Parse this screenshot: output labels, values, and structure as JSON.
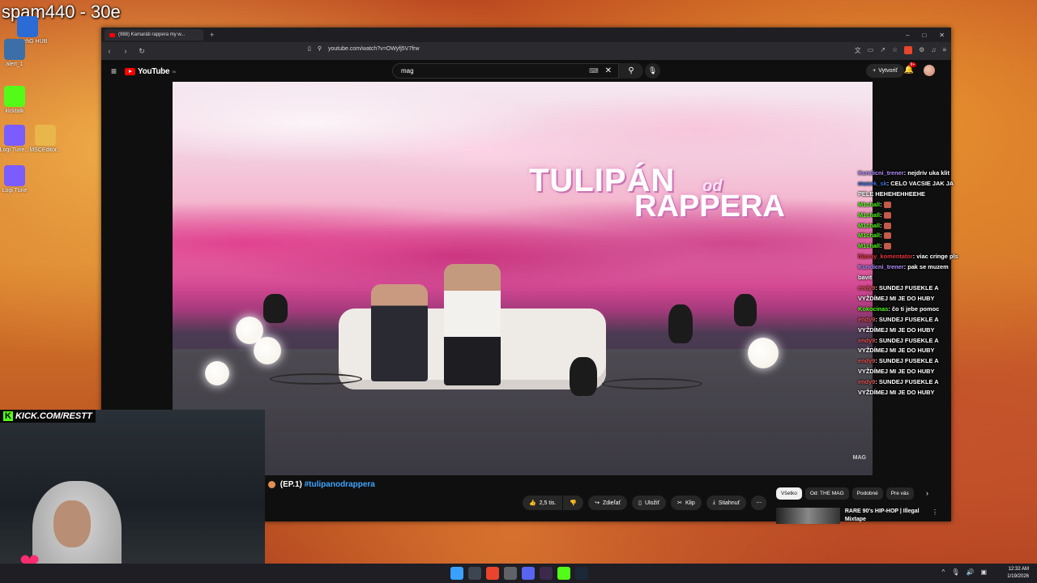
{
  "overlay": {
    "stream_title": "spam440 - 30e",
    "kick_url": "KICK.COM/RESTT",
    "kick_logo": "K"
  },
  "desktop_icons": [
    {
      "label": "LogitechG HUB",
      "icon": "logitech-icon",
      "color": "#2a6bd6"
    },
    {
      "label": "alert_1",
      "icon": "alert-icon",
      "color": "#3c6ea8"
    },
    {
      "label": "kicktalk",
      "icon": "kick-icon",
      "color": "#53fc18"
    },
    {
      "label": "Logi Tune...",
      "icon": "logi-tune-icon",
      "color": "#7b5cff"
    },
    {
      "label": "MSCEditor...",
      "icon": "folder-icon",
      "color": "#e8b64a"
    },
    {
      "label": "Logi Tune",
      "icon": "logi-tune-icon",
      "color": "#7b5cff"
    }
  ],
  "browser": {
    "tab_title": "(988) Kamaráti rappera my w...",
    "url": "youtube.com/watch?v=OWyfj5V7frw",
    "window_controls": [
      "–",
      "□",
      "✕"
    ]
  },
  "youtube": {
    "logo_text": "YouTube",
    "logo_region": "SK",
    "search_value": "mag",
    "create_label": "Vytvoriť",
    "notification_count": "9+",
    "video": {
      "logo_line1": "TULIPÁN",
      "logo_line2": "od",
      "logo_line3": "RAPPERA",
      "watermark": "MAG",
      "title_prefix": "(EP.1)",
      "title_hashtag": "#tulipanodrappera"
    },
    "actions": {
      "likes": "2,5 tis.",
      "share": "Zdieľať",
      "save": "Uložiť",
      "clip": "Klip",
      "download": "Stiahnuť"
    },
    "chips": [
      "Všetko",
      "Od: THE MAG",
      "Podobné",
      "Pre vás"
    ],
    "recommendation": {
      "title": "RARE 90's HIP-HOP | Illegal Mixtape"
    }
  },
  "chat": [
    {
      "user": "Kundicni_trener",
      "message": "nejdriv uka klit",
      "color": "#b38cff"
    },
    {
      "user": "mucek_sk",
      "message": "CELO VACSIE JAK JA PELE HEHEHEHHEEHE",
      "color": "#3a6fe0"
    },
    {
      "user": "M1chall",
      "message": "",
      "color": "#53fc18",
      "emote": true
    },
    {
      "user": "M1chall",
      "message": "",
      "color": "#53fc18",
      "emote": true
    },
    {
      "user": "M1chall",
      "message": "",
      "color": "#53fc18",
      "emote": true
    },
    {
      "user": "M1chall",
      "message": "",
      "color": "#53fc18",
      "emote": true
    },
    {
      "user": "M1chall",
      "message": "",
      "color": "#53fc18",
      "emote": true
    },
    {
      "user": "hlavny_komentator",
      "message": "viac cringe pls",
      "color": "#e3343b"
    },
    {
      "user": "Kundicni_trener",
      "message": "pak se muzem bavit",
      "color": "#b38cff"
    },
    {
      "user": "endy9",
      "message": "SUNDEJ FUSEKLE A VYŽDÍMEJ MI JE DO HUBY",
      "color": "#e05555"
    },
    {
      "user": "Kokocinas",
      "message": "čo ti jebe pomoc",
      "color": "#53fc18"
    },
    {
      "user": "endy9",
      "message": "SUNDEJ FUSEKLE A VYŽDÍMEJ MI JE DO HUBY",
      "color": "#e05555"
    },
    {
      "user": "endy9",
      "message": "SUNDEJ FUSEKLE A VYŽDÍMEJ MI JE DO HUBY",
      "color": "#e05555"
    },
    {
      "user": "endy9",
      "message": "SUNDEJ FUSEKLE A VYŽDÍMEJ MI JE DO HUBY",
      "color": "#e05555"
    },
    {
      "user": "endy9",
      "message": "SUNDEJ FUSEKLE A VYŽDÍMEJ MI JE DO HUBY",
      "color": "#e05555"
    }
  ],
  "taskbar": {
    "apps": [
      {
        "icon": "start-icon",
        "color": "#3aa0ff"
      },
      {
        "icon": "terminal-icon",
        "color": "#3d4452"
      },
      {
        "icon": "brave-icon",
        "color": "#e8452c"
      },
      {
        "icon": "chrome-icon",
        "color": "#5f6368"
      },
      {
        "icon": "discord-icon",
        "color": "#5865f2"
      },
      {
        "icon": "obs-icon",
        "color": "#3b2a4a"
      },
      {
        "icon": "kick-icon",
        "color": "#53fc18"
      },
      {
        "icon": "steam-icon",
        "color": "#1b2838"
      }
    ],
    "time": "12:32 AM",
    "date": "1/19/2026"
  }
}
